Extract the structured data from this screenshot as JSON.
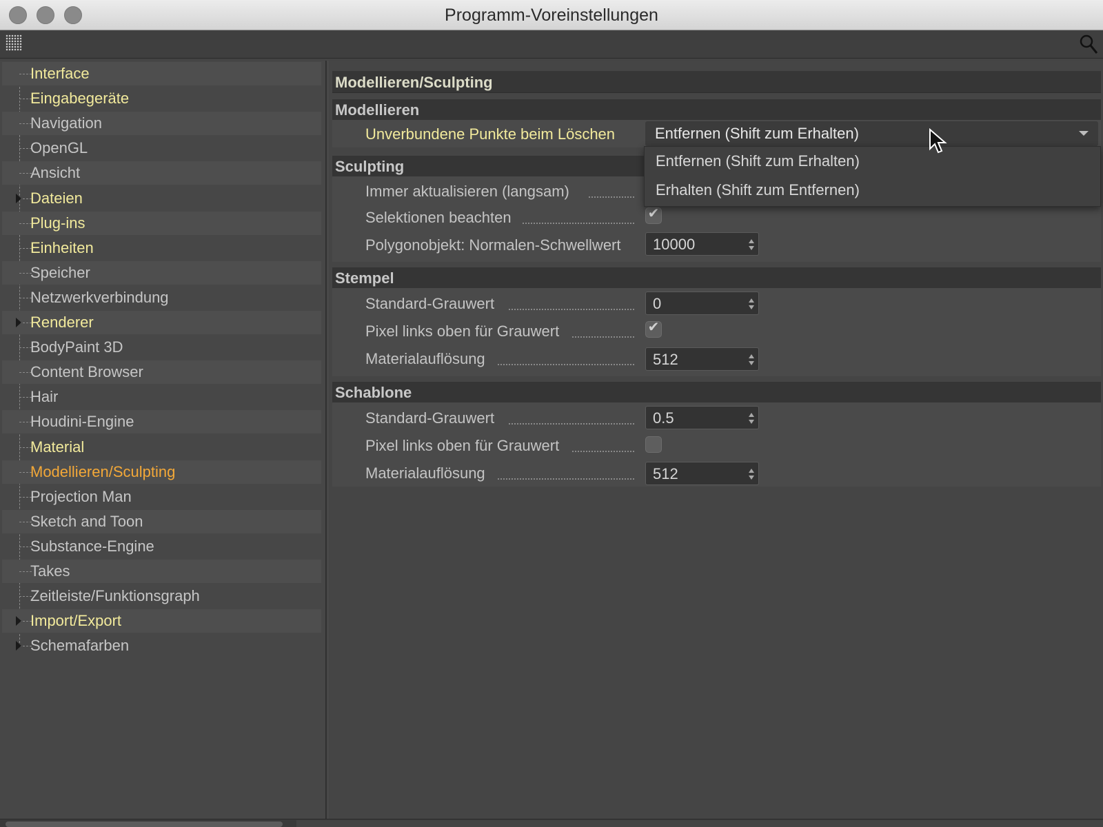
{
  "window": {
    "title": "Programm-Voreinstellungen"
  },
  "toolbar": {
    "menu_icon": "grid-menu-icon",
    "search_icon": "search-icon"
  },
  "sidebar": {
    "items": [
      {
        "label": "Interface",
        "style": "hl",
        "expandable": false
      },
      {
        "label": "Eingabegeräte",
        "style": "hl",
        "expandable": false
      },
      {
        "label": "Navigation",
        "style": "normal",
        "expandable": false
      },
      {
        "label": "OpenGL",
        "style": "normal",
        "expandable": false
      },
      {
        "label": "Ansicht",
        "style": "normal",
        "expandable": false
      },
      {
        "label": "Dateien",
        "style": "hl",
        "expandable": true
      },
      {
        "label": "Plug-ins",
        "style": "hl",
        "expandable": false
      },
      {
        "label": "Einheiten",
        "style": "hl",
        "expandable": false
      },
      {
        "label": "Speicher",
        "style": "normal",
        "expandable": false
      },
      {
        "label": "Netzwerkverbindung",
        "style": "normal",
        "expandable": false
      },
      {
        "label": "Renderer",
        "style": "hl",
        "expandable": true
      },
      {
        "label": "BodyPaint 3D",
        "style": "normal",
        "expandable": false
      },
      {
        "label": "Content Browser",
        "style": "normal",
        "expandable": false
      },
      {
        "label": "Hair",
        "style": "normal",
        "expandable": false
      },
      {
        "label": "Houdini-Engine",
        "style": "normal",
        "expandable": false
      },
      {
        "label": "Material",
        "style": "hl",
        "expandable": false
      },
      {
        "label": "Modellieren/Sculpting",
        "style": "sel",
        "expandable": false
      },
      {
        "label": "Projection Man",
        "style": "normal",
        "expandable": false
      },
      {
        "label": "Sketch and Toon",
        "style": "normal",
        "expandable": false
      },
      {
        "label": "Substance-Engine",
        "style": "normal",
        "expandable": false
      },
      {
        "label": "Takes",
        "style": "normal",
        "expandable": false
      },
      {
        "label": "Zeitleiste/Funktionsgraph",
        "style": "normal",
        "expandable": false
      },
      {
        "label": "Import/Export",
        "style": "hl",
        "expandable": true
      },
      {
        "label": "Schemafarben",
        "style": "normal",
        "expandable": true
      }
    ]
  },
  "main": {
    "group_title": "Modellieren/Sculpting",
    "modellieren": {
      "header": "Modellieren",
      "unconnected_points_label": "Unverbundene Punkte beim Löschen",
      "unconnected_points_value": "Entfernen (Shift zum Erhalten)",
      "dropdown_options": [
        "Entfernen (Shift zum Erhalten)",
        "Erhalten (Shift zum Entfernen)"
      ]
    },
    "sculpting": {
      "header": "Sculpting",
      "always_update_label": "Immer aktualisieren (langsam)",
      "respect_selection_label": "Selektionen beachten",
      "respect_selection_checked": true,
      "normal_threshold_label": "Polygonobjekt: Normalen-Schwellwert",
      "normal_threshold_value": "10000"
    },
    "stempel": {
      "header": "Stempel",
      "gray_label": "Standard-Grauwert",
      "gray_value": "0",
      "pixel_label": "Pixel links oben für Grauwert",
      "pixel_checked": true,
      "resolution_label": "Materialauflösung",
      "resolution_value": "512"
    },
    "schablone": {
      "header": "Schablone",
      "gray_label": "Standard-Grauwert",
      "gray_value": "0.5",
      "pixel_label": "Pixel links oben für Grauwert",
      "pixel_checked": false,
      "resolution_label": "Materialauflösung",
      "resolution_value": "512"
    }
  },
  "colors": {
    "highlight_label": "#f2ea9c",
    "selected_label": "#f3a838",
    "background": "#444444"
  }
}
